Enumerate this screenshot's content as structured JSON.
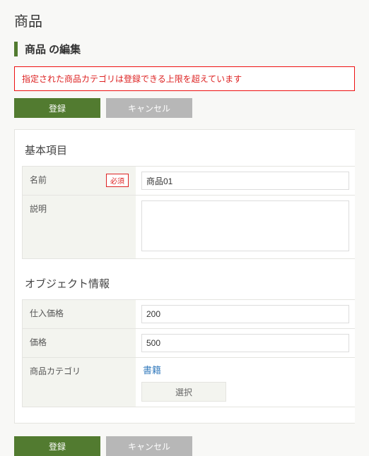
{
  "page_title": "商品",
  "section_title": "商品 の編集",
  "error_message": "指定された商品カテゴリは登録できる上限を超えています",
  "buttons": {
    "register": "登録",
    "cancel": "キャンセル"
  },
  "basic_section": {
    "title": "基本項目",
    "fields": {
      "name": {
        "label": "名前",
        "required_label": "必須",
        "value": "商品01"
      },
      "description": {
        "label": "説明",
        "value": ""
      }
    }
  },
  "object_section": {
    "title": "オブジェクト情報",
    "fields": {
      "cost_price": {
        "label": "仕入価格",
        "value": "200"
      },
      "price": {
        "label": "価格",
        "value": "500"
      },
      "category": {
        "label": "商品カテゴリ",
        "selected": "書籍",
        "select_button": "選択"
      }
    }
  }
}
